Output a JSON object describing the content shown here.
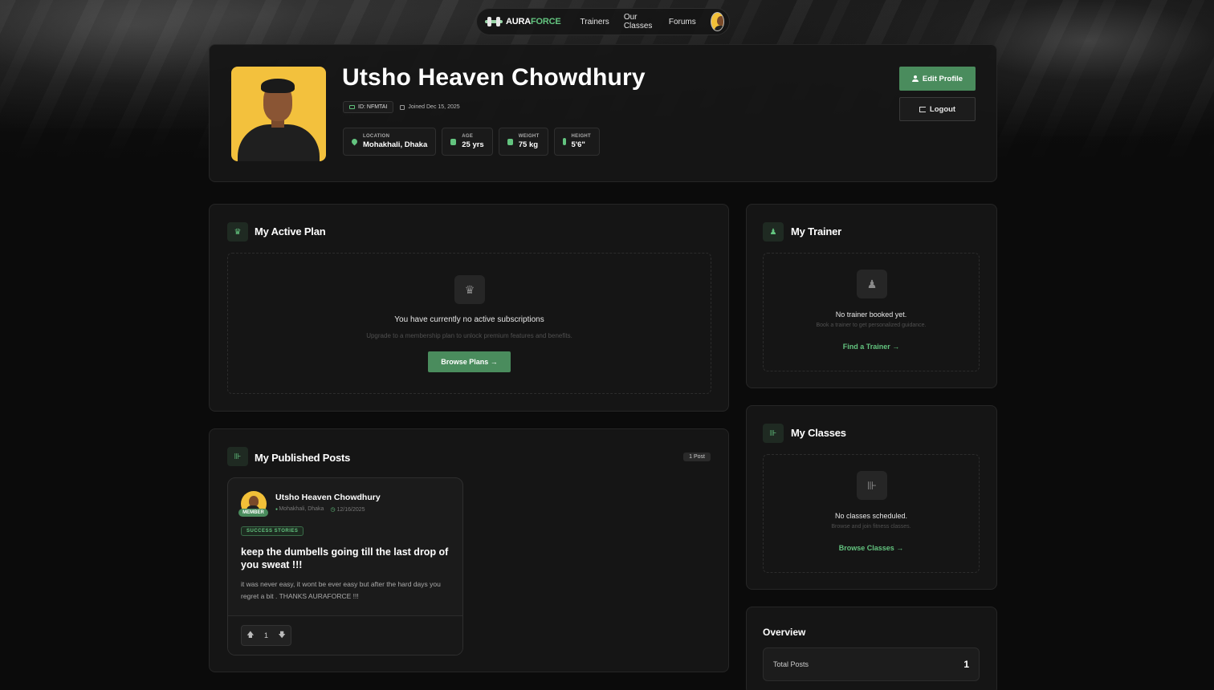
{
  "nav": {
    "logo_a": "AURA",
    "logo_b": "FORCE",
    "links": [
      "Trainers",
      "Our Classes",
      "Forums"
    ]
  },
  "profile": {
    "name": "Utsho Heaven Chowdhury",
    "id_label": "ID: NFMTAI",
    "joined": "Joined Dec 15, 2025",
    "stats": [
      {
        "label": "LOCATION",
        "value": "Mohakhali, Dhaka",
        "icon": "location-pin-icon"
      },
      {
        "label": "AGE",
        "value": "25 yrs",
        "icon": "age-icon"
      },
      {
        "label": "WEIGHT",
        "value": "75 kg",
        "icon": "weight-icon"
      },
      {
        "label": "HEIGHT",
        "value": "5'6\"",
        "icon": "height-icon"
      }
    ],
    "edit_label": "Edit Profile",
    "logout_label": "Logout"
  },
  "plan": {
    "title": "My Active Plan",
    "empty_title": "You have currently no active subscriptions",
    "empty_sub": "Upgrade to a membership plan to unlock premium features and benefits.",
    "button": "Browse Plans →"
  },
  "trainer": {
    "title": "My Trainer",
    "empty_title": "No trainer booked yet.",
    "empty_sub": "Book a trainer to get personalized guidance.",
    "link": "Find a Trainer →"
  },
  "classes": {
    "title": "My Classes",
    "empty_title": "No classes scheduled.",
    "empty_sub": "Browse and join fitness classes.",
    "link": "Browse Classes →"
  },
  "posts": {
    "title": "My Published Posts",
    "count": "1 Post",
    "items": [
      {
        "author": "Utsho Heaven Chowdhury",
        "badge": "MEMBER",
        "location": "Mohakhali, Dhaka",
        "date": "12/16/2025",
        "tag": "SUCCESS STORIES",
        "title": "keep the dumbells going till the last drop of you sweat !!!",
        "body": "it was never easy, it wont be ever easy but after the hard days you regret a bit . THANKS AURAFORCE !!!",
        "votes": "1"
      }
    ]
  },
  "overview": {
    "title": "Overview",
    "rows": [
      {
        "label": "Total Posts",
        "value": "1"
      }
    ]
  },
  "colors": {
    "accent": "#63c47f",
    "button_green": "#4a8c5d",
    "card_bg": "#151515",
    "page_bg": "#0b0b0b"
  }
}
